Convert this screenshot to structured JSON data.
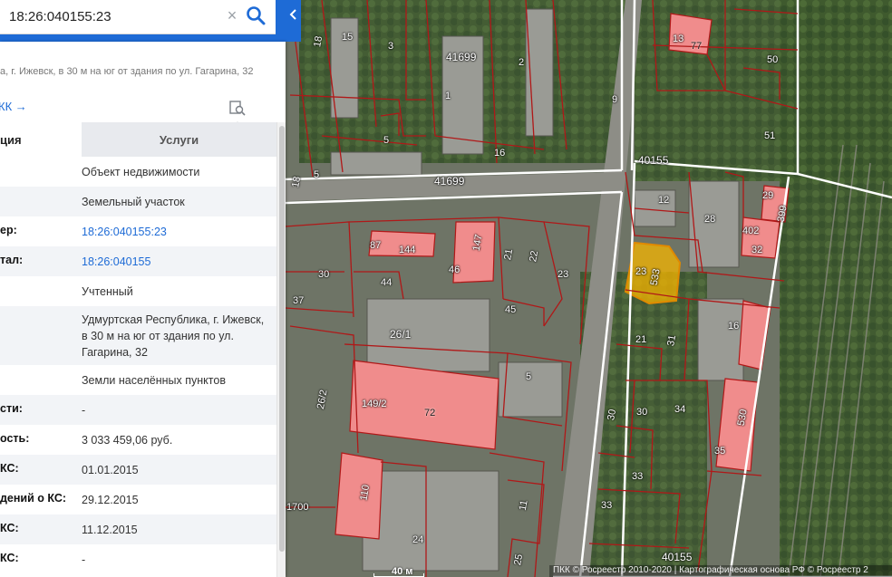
{
  "search": {
    "value": "18:26:040155:23",
    "clear_glyph": "×"
  },
  "address_line": "а, г. Ижевск, в 30 м на юг от здания по ул. Гагарина, 32",
  "pkk_link": "КК →",
  "tabs": {
    "info": "ция",
    "services": "Услуги"
  },
  "rows": [
    {
      "key": "",
      "value": "Объект недвижимости"
    },
    {
      "key": "",
      "value": "Земельный участок"
    },
    {
      "key": "ер:",
      "value": "18:26:040155:23"
    },
    {
      "key": "тал:",
      "value": "18:26:040155"
    },
    {
      "key": "",
      "value": "Учтенный"
    },
    {
      "key": "",
      "value": "Удмуртская Республика, г. Ижевск, в 30 м на юг от здания по ул. Гагарина, 32"
    },
    {
      "key": "",
      "value": "Земли населённых пунктов"
    },
    {
      "key": "сти:",
      "value": "-"
    },
    {
      "key": "ость:",
      "value": "3 033 459,06 руб."
    },
    {
      "key": "КС:",
      "value": "01.01.2015"
    },
    {
      "key": "дений о КС:",
      "value": "29.12.2015"
    },
    {
      "key": "КС:",
      "value": "11.12.2015"
    },
    {
      "key": "КС:",
      "value": "-"
    }
  ],
  "map": {
    "labels": [
      "18",
      "15",
      "3",
      "13",
      "77",
      "50",
      "41699",
      "2",
      "1",
      "9",
      "5",
      "51",
      "16",
      "18",
      "5",
      "41699",
      "40155",
      "12",
      "28",
      "29",
      "399",
      "402",
      "32",
      "87",
      "144",
      "147",
      "21",
      "22",
      "23",
      "46",
      "30",
      "44",
      "45",
      "23",
      "533",
      "37",
      "26/1",
      "21",
      "31",
      "16",
      "5",
      "149/2",
      "72",
      "26/2",
      "34",
      "30",
      "30",
      "530",
      "35",
      "33",
      "33",
      "11",
      "1700",
      "110",
      "24",
      "25",
      "40155"
    ],
    "scale_label": "40 м",
    "copyright": "ПКК © Росреестр 2010-2020 | Картографическая основа РФ © Росреестр 2",
    "colors": {
      "parcel_border": "#b01818",
      "block_border": "#ffffff",
      "building_fill": "#f08c8c",
      "selected_fill": "#f5b400",
      "panel_accent": "#1e6bd6"
    }
  },
  "icons": {
    "search": "search-icon",
    "clear": "close-icon",
    "collapse": "chevron-left-icon",
    "zoom_doc": "zoom-document-icon",
    "favorite": "star-icon"
  }
}
